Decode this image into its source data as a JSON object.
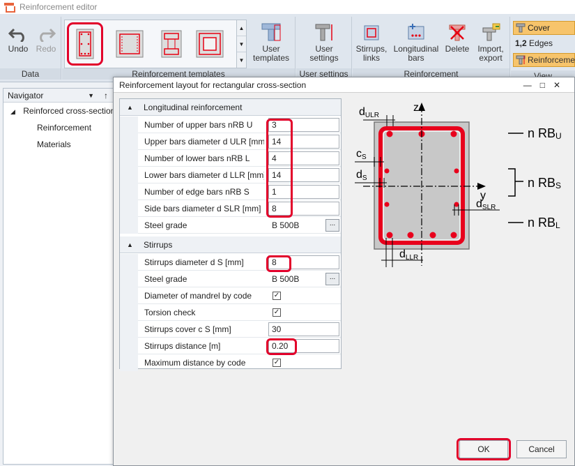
{
  "window": {
    "title": "Reinforcement editor"
  },
  "ribbon": {
    "undo": "Undo",
    "redo": "Redo",
    "data_group": "Data",
    "user_templates": "User templates",
    "reinf_templates_group": "Reinforcement templates",
    "user_settings": "User settings",
    "user_settings_group": "User settings",
    "stirrups_links": "Stirrups, links",
    "longitudinal_bars": "Longitudinal bars",
    "delete": "Delete",
    "import_export": "Import, export",
    "reinforcement_group": "Reinforcement",
    "cover": "Cover",
    "edges": "Edges",
    "edges_prefix": "1,2",
    "reinforcement_toggle": "Reinforcement",
    "view_group": "View"
  },
  "navigator": {
    "title": "Navigator",
    "root": "Reinforced cross-section",
    "items": [
      "Reinforcement",
      "Materials"
    ]
  },
  "dialog": {
    "title": "Reinforcement layout for rectangular cross-section",
    "sections": {
      "longitudinal": "Longitudinal reinforcement",
      "stirrups": "Stirrups"
    },
    "longitudinal_rows": [
      {
        "label": "Number of upper bars nRB U",
        "value": "3"
      },
      {
        "label": "Upper bars diameter d ULR [mm]",
        "value": "14"
      },
      {
        "label": "Number of lower bars nRB L",
        "value": "4"
      },
      {
        "label": "Lower bars diameter d LLR [mm]",
        "value": "14"
      },
      {
        "label": "Number of edge bars nRB S",
        "value": "1"
      },
      {
        "label": "Side bars diameter d SLR [mm]",
        "value": "8"
      }
    ],
    "steel_grade_label": "Steel grade",
    "steel_grade_value": "B 500B",
    "stirrup_rows": {
      "diameter_label": "Stirrups diameter d S [mm]",
      "diameter_value": "8",
      "steel_label": "Steel grade",
      "steel_value": "B 500B",
      "mandrel_label": "Diameter of mandrel by code",
      "torsion_label": "Torsion check",
      "cover_label": "Stirrups cover c S [mm]",
      "cover_value": "30",
      "distance_label": "Stirrups distance [m]",
      "distance_value": "0.20",
      "maxdist_label": "Maximum distance by code"
    },
    "ok": "OK",
    "cancel": "Cancel"
  },
  "diagram": {
    "z": "z",
    "y": "y",
    "d": "d",
    "c": "c",
    "sub_ulr": "ULR",
    "sub_s": "S",
    "sub_slr": "SLR",
    "sub_llr": "LLR",
    "nrb": "n RB",
    "sub_u": "U",
    "sub_l": "L"
  },
  "colors": {
    "highlight": "#e2002a",
    "rebar": "#e8001c",
    "section": "#c8c8c8"
  }
}
